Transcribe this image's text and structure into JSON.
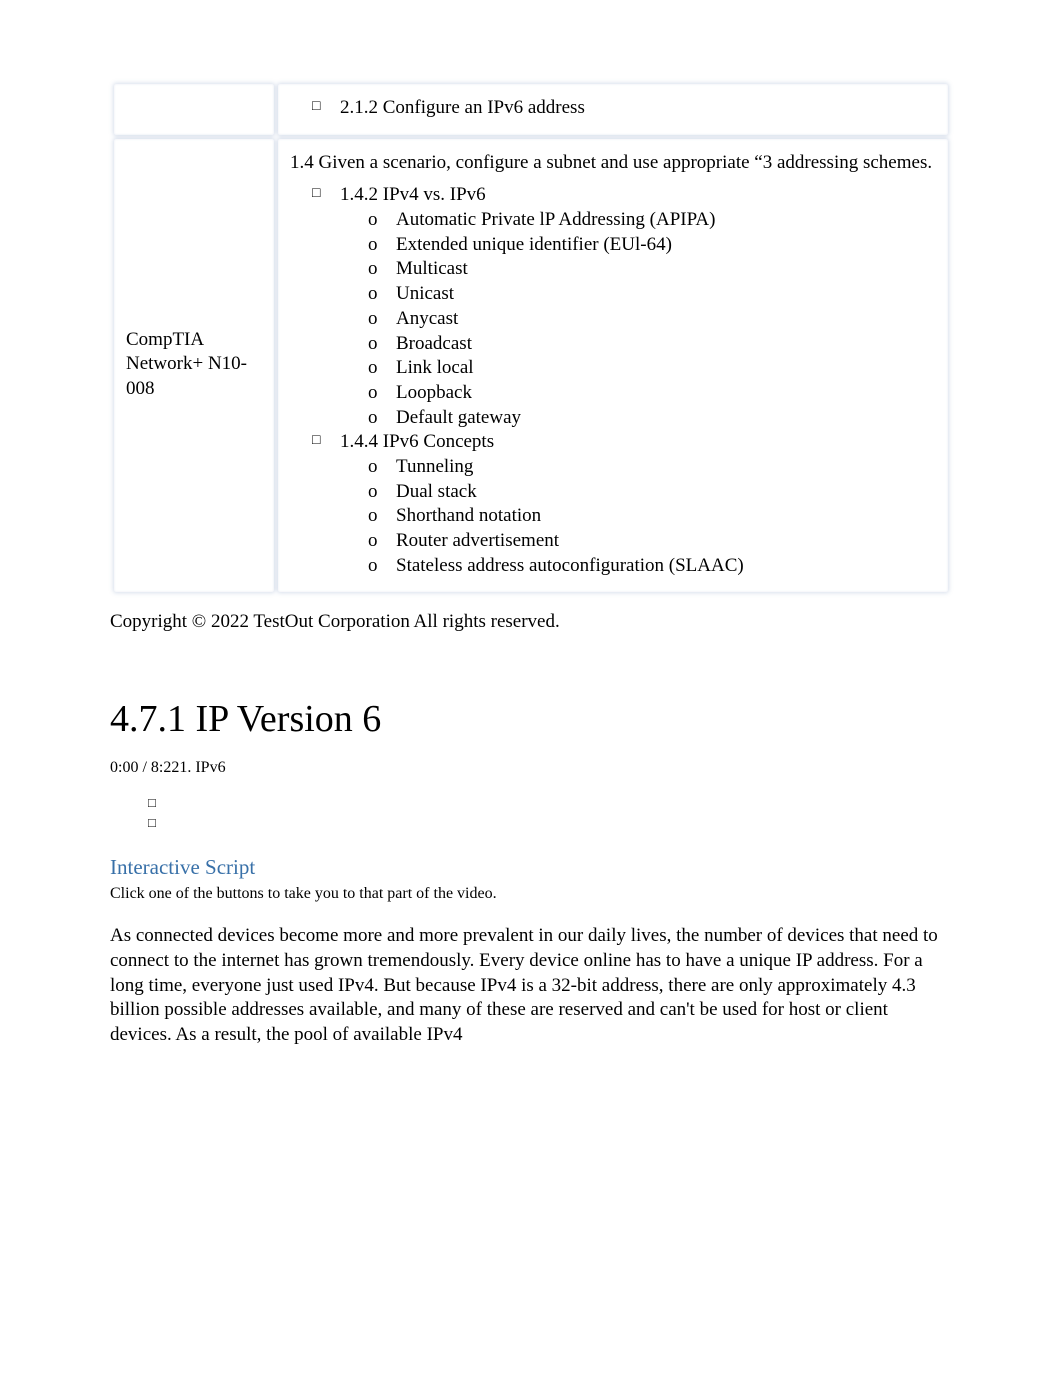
{
  "row1": {
    "leftLabel": "",
    "item": "2.1.2 Configure an IPv6 address"
  },
  "row2": {
    "leftLabel": "CompTIA Network+ N10-008",
    "intro": "1.4 Given a scenario, configure a subnet and use appropriate “3 addressing schemes.",
    "list1Label": "1.4.2 IPv4 vs. IPv6",
    "list1Items": [
      "Automatic Private lP Addressing (APIPA)",
      "Extended unique identifier (EUl-64)",
      "Multicast",
      "Unicast",
      "Anycast",
      "Broadcast",
      "Link local",
      "Loopback",
      "Default gateway"
    ],
    "list2Label": "1.4.4 IPv6 Concepts",
    "list2Items": [
      "Tunneling",
      "Dual stack",
      "Shorthand notation",
      "Router advertisement",
      "Stateless address autoconfiguration (SLAAC)"
    ]
  },
  "copyright": "Copyright © 2022 TestOut Corporation All rights reserved.",
  "sectionTitle": "4.7.1 IP Version 6",
  "timecode": "0:00 / 8:221. IPv6",
  "scriptHeading": "Interactive Script",
  "scriptSub": "Click one of the buttons to take you to that part of the video.",
  "paragraph": "As connected devices become more and more prevalent in our daily lives, the number of devices that need to connect to the internet has grown tremendously. Every device online has to have a unique IP address. For a long time, everyone just used IPv4. But because IPv4 is a 32-bit address, there are only approximately 4.3 billion possible addresses available, and many of these are reserved and can't be used for host or client devices. As a result, the pool of available IPv4"
}
